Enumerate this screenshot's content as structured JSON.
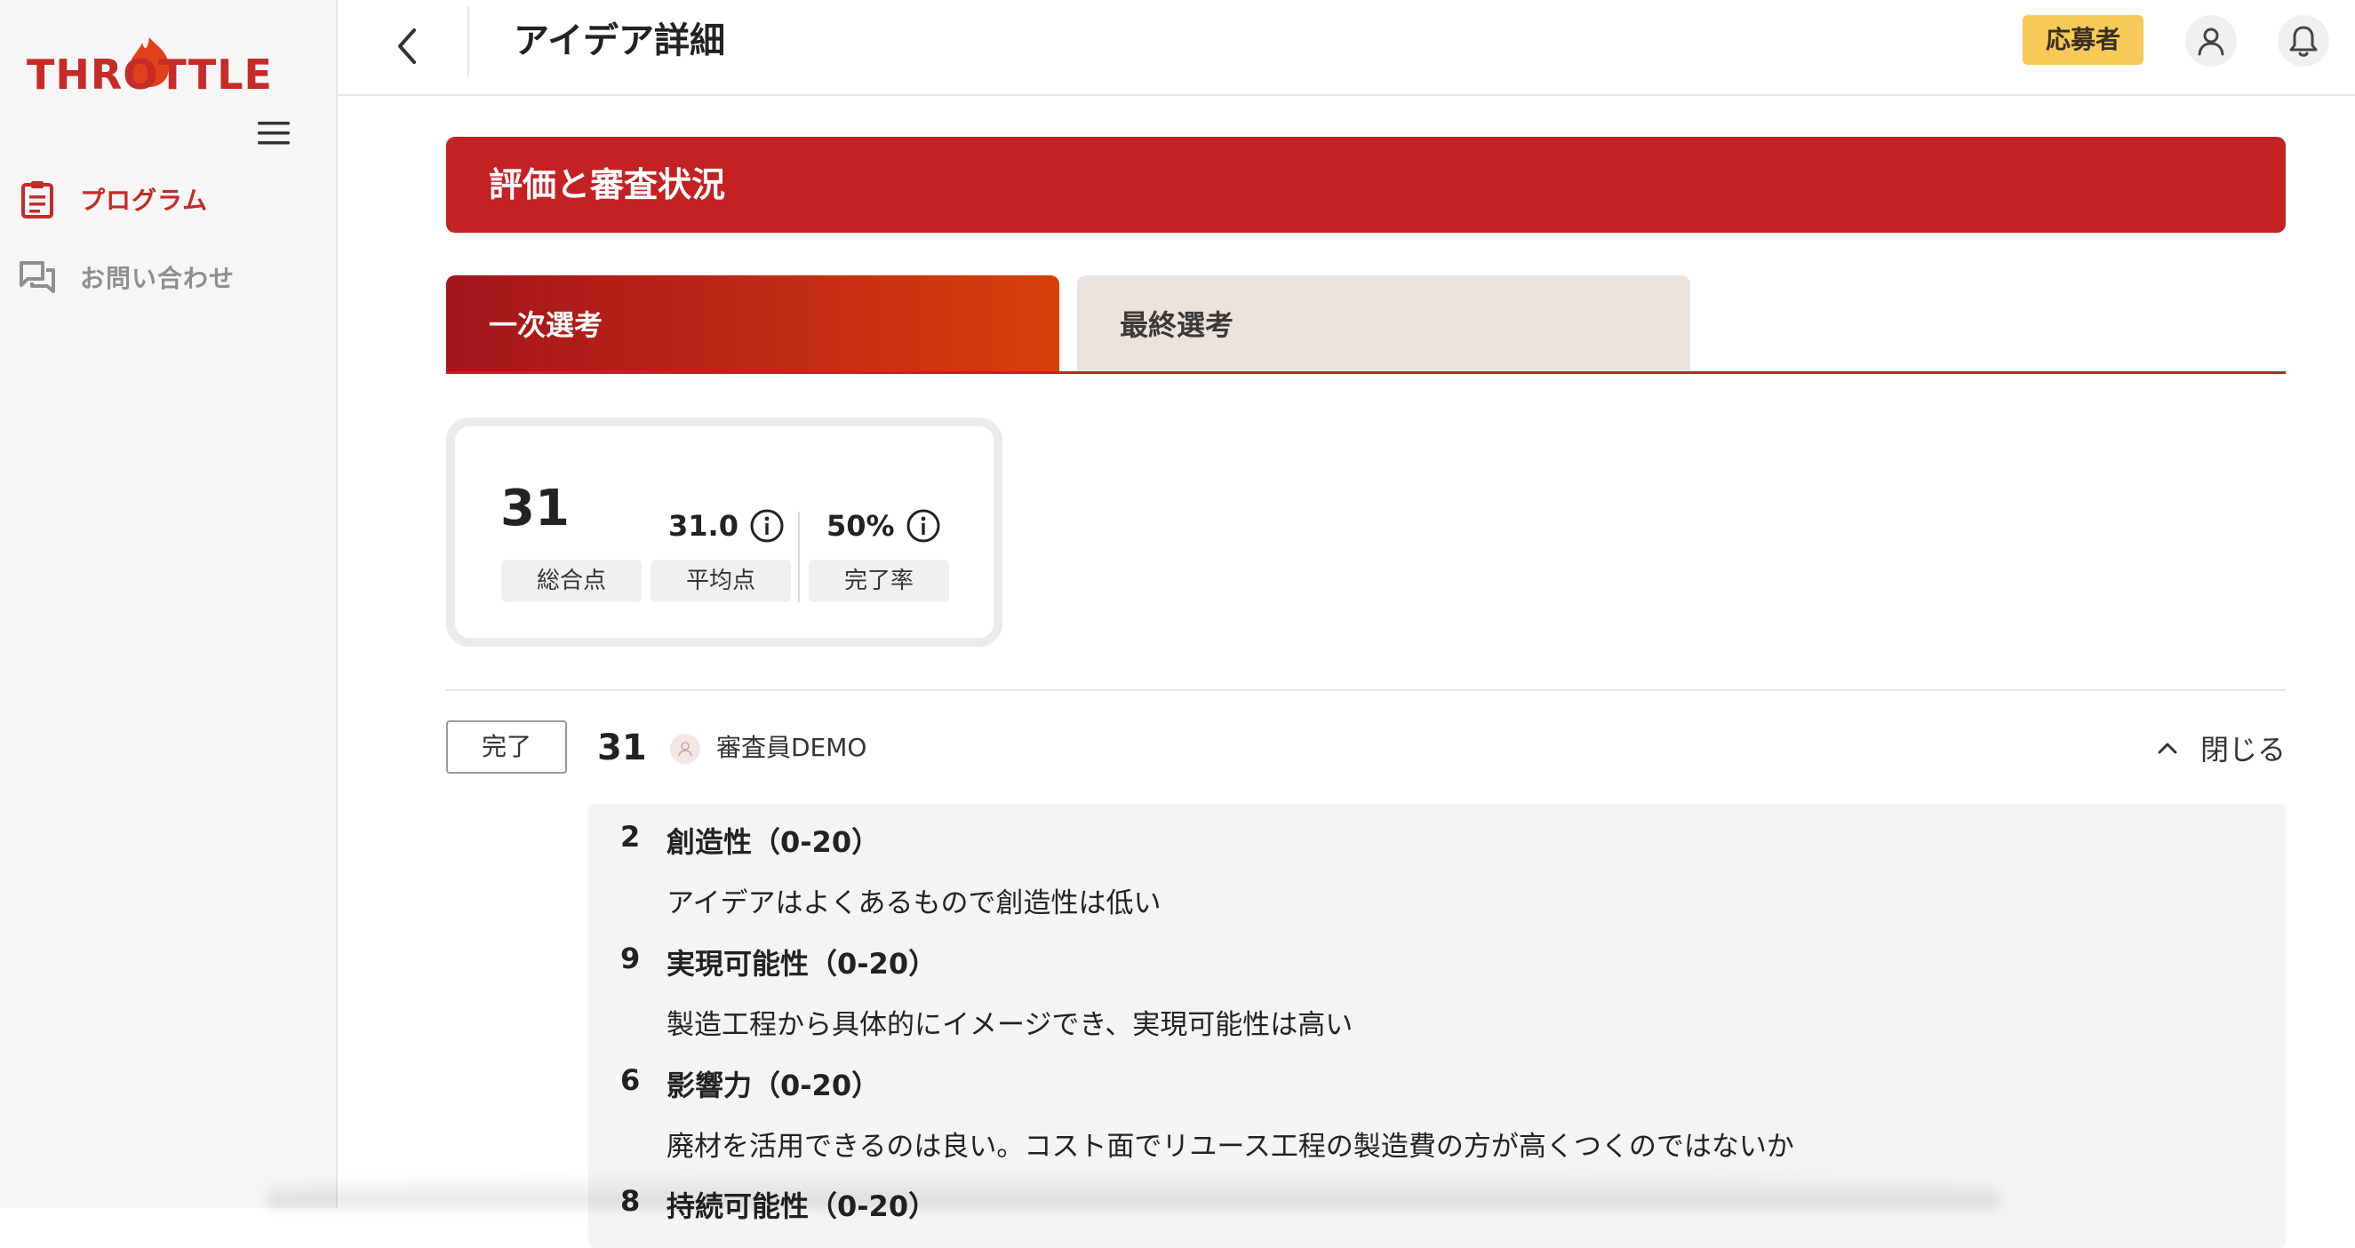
{
  "sidebar": {
    "logo_text": "THROTTLE",
    "items": [
      {
        "label": "プログラム",
        "icon": "clipboard-icon",
        "active": true
      },
      {
        "label": "お問い合わせ",
        "icon": "chat-icon",
        "active": false
      }
    ]
  },
  "header": {
    "title": "アイデア詳細",
    "role_badge": "応募者"
  },
  "section": {
    "title": "評価と審査状況"
  },
  "tabs": [
    {
      "label": "一次選考",
      "active": true
    },
    {
      "label": "最終選考",
      "active": false
    }
  ],
  "score_card": {
    "total": "31",
    "total_label": "総合点",
    "average": "31.0",
    "average_label": "平均点",
    "completion": "50%",
    "completion_label": "完了率"
  },
  "review": {
    "status": "完了",
    "score": "31",
    "reviewer": "審査員DEMO",
    "toggle_label": "閉じる"
  },
  "criteria": [
    {
      "score": "2",
      "title": "創造性（0-20）",
      "comment": "アイデアはよくあるもので創造性は低い"
    },
    {
      "score": "9",
      "title": "実現可能性（0-20）",
      "comment": "製造工程から具体的にイメージでき、実現可能性は高い"
    },
    {
      "score": "6",
      "title": "影響力（0-20）",
      "comment": "廃材を活用できるのは良い。コスト面でリユース工程の製造費の方が高くつくのではないか"
    },
    {
      "score": "8",
      "title": "持続可能性（0-20）"
    }
  ],
  "colors": {
    "brand_red": "#c42122",
    "badge_yellow": "#f7c957",
    "inactive_tab": "#ebe3de"
  }
}
